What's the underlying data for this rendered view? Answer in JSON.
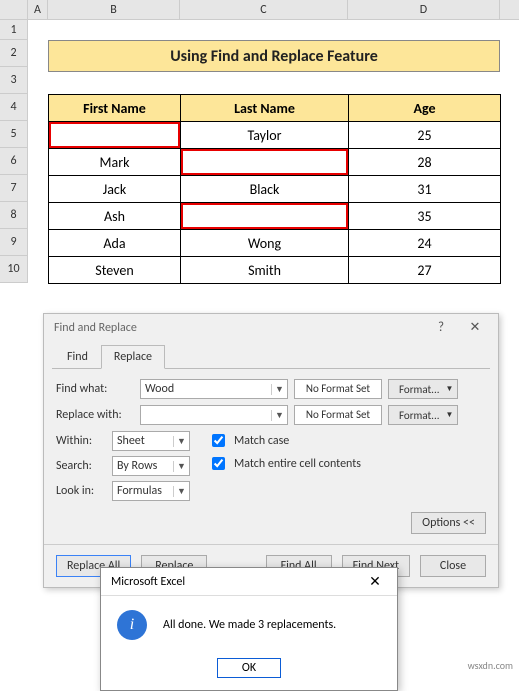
{
  "columns": [
    "A",
    "B",
    "C",
    "D"
  ],
  "rows": [
    "1",
    "2",
    "3",
    "4",
    "5",
    "6",
    "7",
    "8",
    "9",
    "10"
  ],
  "title": "Using Find and Replace Feature",
  "table": {
    "headers": {
      "first": "First Name",
      "last": "Last Name",
      "age": "Age"
    },
    "data": [
      {
        "first": "",
        "last": "Taylor",
        "age": "25",
        "red": "first"
      },
      {
        "first": "Mark",
        "last": "",
        "age": "28",
        "red": "last"
      },
      {
        "first": "Jack",
        "last": "Black",
        "age": "31",
        "red": null
      },
      {
        "first": "Ash",
        "last": "",
        "age": "35",
        "red": "last"
      },
      {
        "first": "Ada",
        "last": "Wong",
        "age": "24",
        "red": null
      },
      {
        "first": "Steven",
        "last": "Smith",
        "age": "27",
        "red": null
      }
    ]
  },
  "find_replace": {
    "title": "Find and Replace",
    "help": "?",
    "close": "✕",
    "tabs": {
      "find": "Find",
      "replace": "Replace"
    },
    "find_what_label": "Find what:",
    "find_what_value": "Wood",
    "replace_with_label": "Replace with:",
    "replace_with_value": "",
    "no_format": "No Format Set",
    "format_btn": "Format...",
    "within_label": "Within:",
    "within_value": "Sheet",
    "search_label": "Search:",
    "search_value": "By Rows",
    "lookin_label": "Look in:",
    "lookin_value": "Formulas",
    "match_case": "Match case",
    "match_entire": "Match entire cell contents",
    "options_btn": "Options <<",
    "buttons": {
      "replace_all": "Replace All",
      "replace": "Replace",
      "find_all": "Find All",
      "find_next": "Find Next",
      "close": "Close"
    }
  },
  "msgbox": {
    "title": "Microsoft Excel",
    "text": "All done. We made 3 replacements.",
    "ok": "OK"
  },
  "watermark": "wsxdn.com"
}
